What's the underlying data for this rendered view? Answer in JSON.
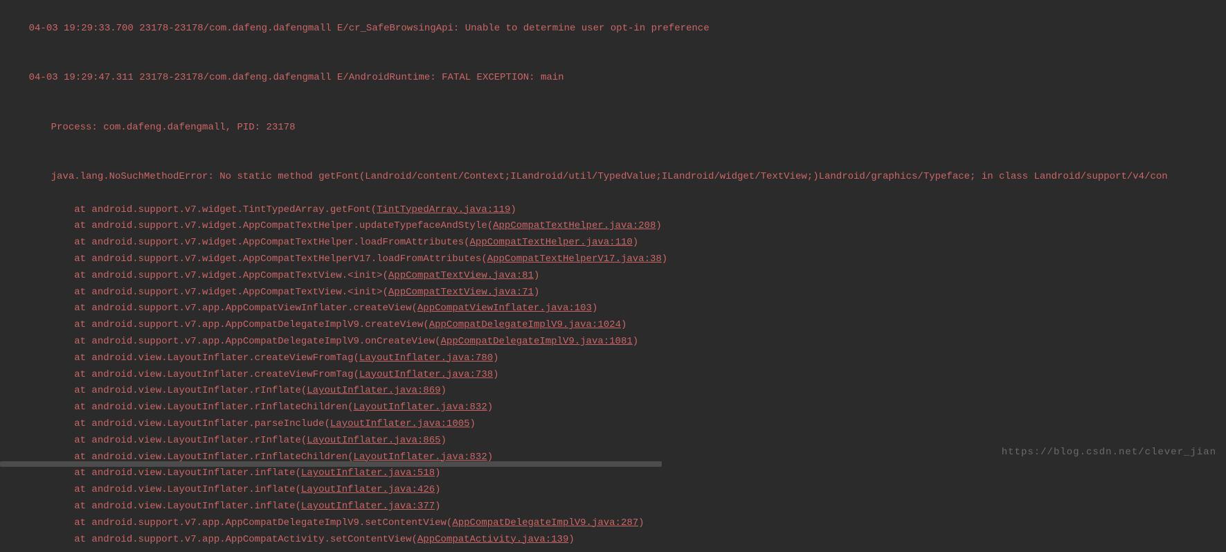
{
  "header_lines": [
    {
      "ts": "04-03 19:29:33.700",
      "pid": "23178-23178/com.dafeng.dafengmall",
      "tag": "E/cr_SafeBrowsingApi:",
      "msg": "Unable to determine user opt-in preference"
    },
    {
      "ts": "04-03 19:29:47.311",
      "pid": "23178-23178/com.dafeng.dafengmall",
      "tag": "E/AndroidRuntime:",
      "msg": "FATAL EXCEPTION: main"
    }
  ],
  "process_line": "Process: com.dafeng.dafengmall, PID: 23178",
  "error_line": "java.lang.NoSuchMethodError: No static method getFont(Landroid/content/Context;ILandroid/util/TypedValue;ILandroid/widget/TextView;)Landroid/graphics/Typeface; in class Landroid/support/v4/con",
  "stack": [
    {
      "prefix": "at android.support.v7.widget.TintTypedArray.getFont",
      "link": "TintTypedArray.java:119"
    },
    {
      "prefix": "at android.support.v7.widget.AppCompatTextHelper.updateTypefaceAndStyle",
      "link": "AppCompatTextHelper.java:208"
    },
    {
      "prefix": "at android.support.v7.widget.AppCompatTextHelper.loadFromAttributes",
      "link": "AppCompatTextHelper.java:110"
    },
    {
      "prefix": "at android.support.v7.widget.AppCompatTextHelperV17.loadFromAttributes",
      "link": "AppCompatTextHelperV17.java:38"
    },
    {
      "prefix": "at android.support.v7.widget.AppCompatTextView.<init>",
      "link": "AppCompatTextView.java:81"
    },
    {
      "prefix": "at android.support.v7.widget.AppCompatTextView.<init>",
      "link": "AppCompatTextView.java:71"
    },
    {
      "prefix": "at android.support.v7.app.AppCompatViewInflater.createView",
      "link": "AppCompatViewInflater.java:103"
    },
    {
      "prefix": "at android.support.v7.app.AppCompatDelegateImplV9.createView",
      "link": "AppCompatDelegateImplV9.java:1024"
    },
    {
      "prefix": "at android.support.v7.app.AppCompatDelegateImplV9.onCreateView",
      "link": "AppCompatDelegateImplV9.java:1081"
    },
    {
      "prefix": "at android.view.LayoutInflater.createViewFromTag",
      "link": "LayoutInflater.java:780"
    },
    {
      "prefix": "at android.view.LayoutInflater.createViewFromTag",
      "link": "LayoutInflater.java:738"
    },
    {
      "prefix": "at android.view.LayoutInflater.rInflate",
      "link": "LayoutInflater.java:869"
    },
    {
      "prefix": "at android.view.LayoutInflater.rInflateChildren",
      "link": "LayoutInflater.java:832"
    },
    {
      "prefix": "at android.view.LayoutInflater.parseInclude",
      "link": "LayoutInflater.java:1005"
    },
    {
      "prefix": "at android.view.LayoutInflater.rInflate",
      "link": "LayoutInflater.java:865"
    },
    {
      "prefix": "at android.view.LayoutInflater.rInflateChildren",
      "link": "LayoutInflater.java:832"
    },
    {
      "prefix": "at android.view.LayoutInflater.inflate",
      "link": "LayoutInflater.java:518"
    },
    {
      "prefix": "at android.view.LayoutInflater.inflate",
      "link": "LayoutInflater.java:426"
    },
    {
      "prefix": "at android.view.LayoutInflater.inflate",
      "link": "LayoutInflater.java:377"
    },
    {
      "prefix": "at android.support.v7.app.AppCompatDelegateImplV9.setContentView",
      "link": "AppCompatDelegateImplV9.java:287"
    },
    {
      "prefix": "at android.support.v7.app.AppCompatActivity.setContentView",
      "link": "AppCompatActivity.java:139"
    }
  ],
  "watermark": "https://blog.csdn.net/clever_jian",
  "indent_stack": "        "
}
